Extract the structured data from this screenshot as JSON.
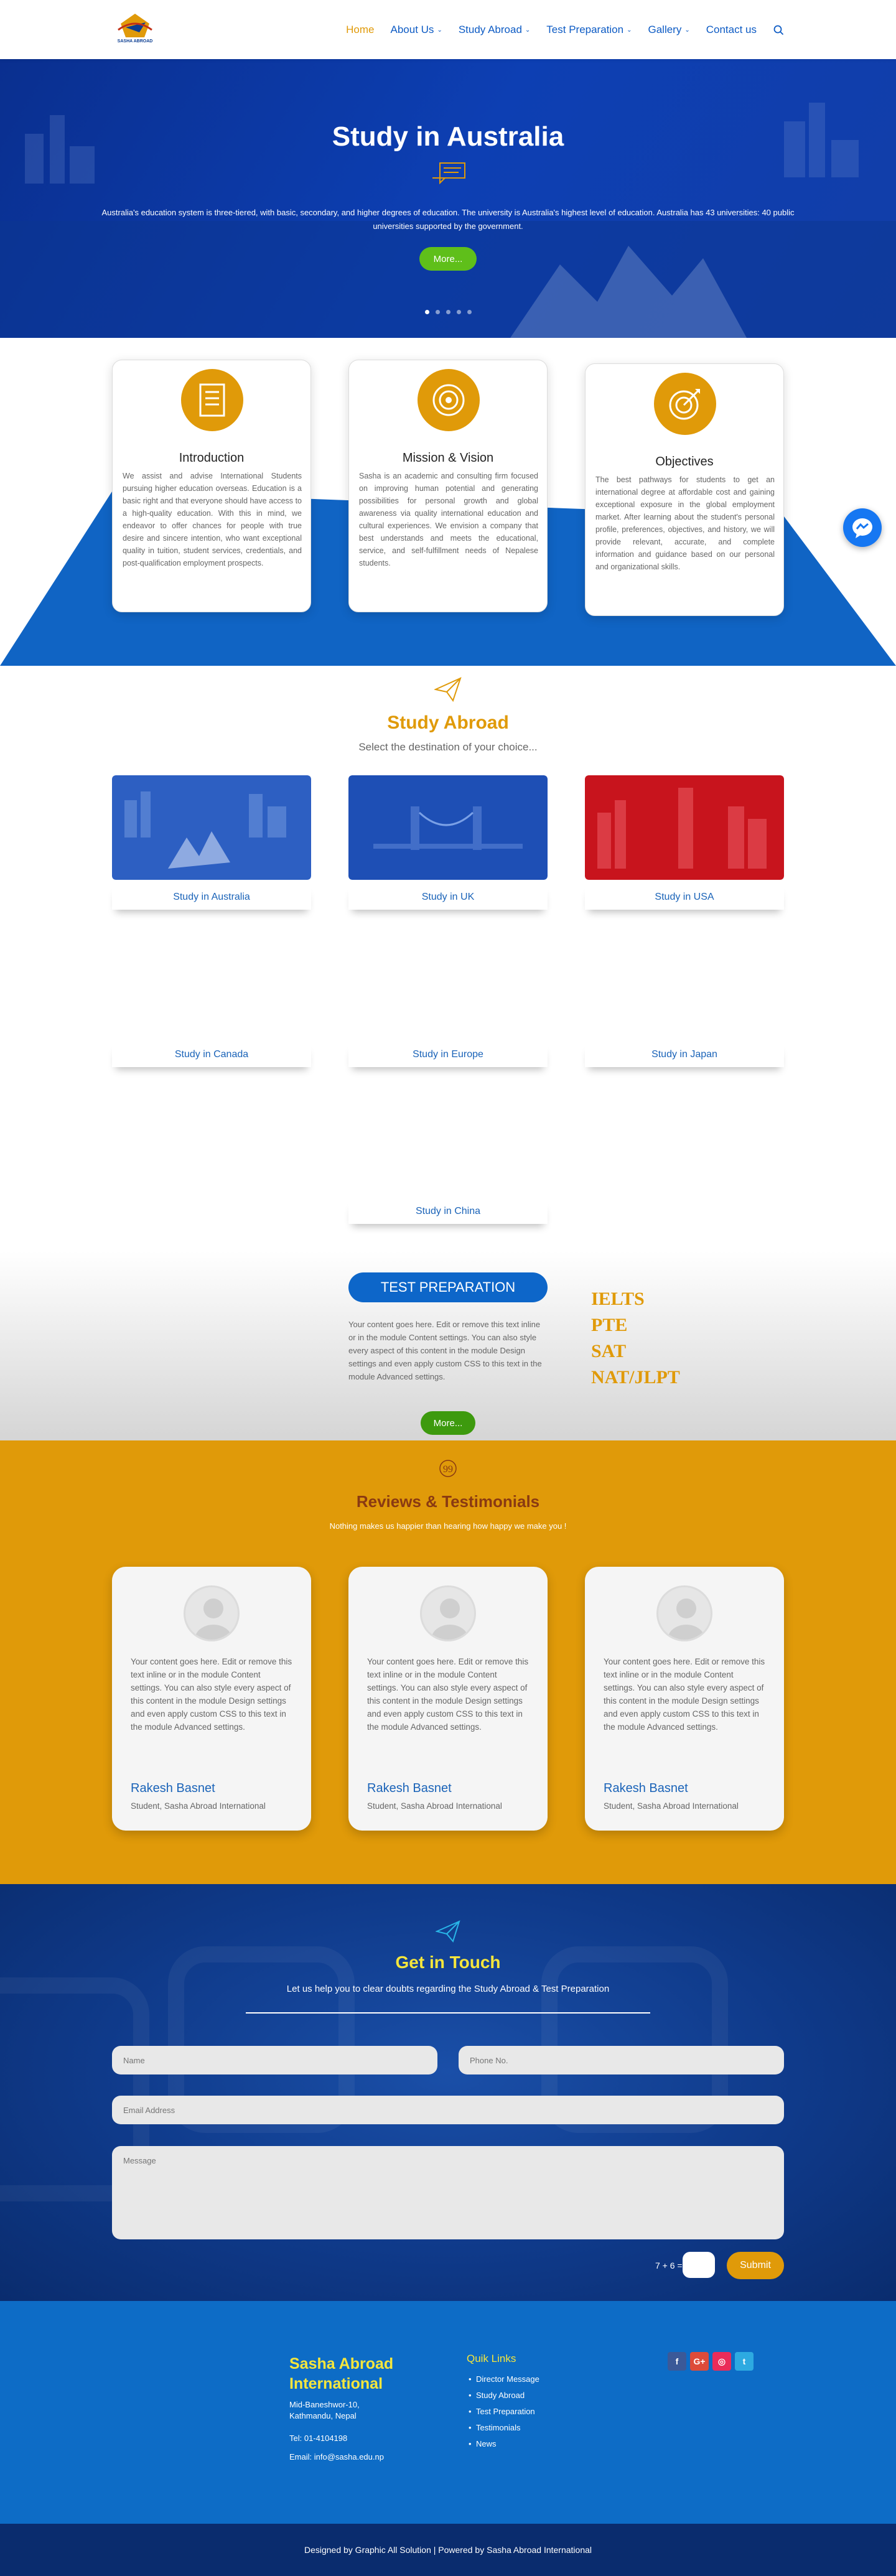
{
  "header": {
    "logo_text": "SASHA ABROAD",
    "nav": [
      {
        "label": "Home",
        "active": true,
        "dropdown": false
      },
      {
        "label": "About Us",
        "active": false,
        "dropdown": true
      },
      {
        "label": "Study Abroad",
        "active": false,
        "dropdown": true
      },
      {
        "label": "Test Preparation",
        "active": false,
        "dropdown": true
      },
      {
        "label": "Gallery",
        "active": false,
        "dropdown": true
      },
      {
        "label": "Contact us",
        "active": false,
        "dropdown": false
      }
    ]
  },
  "hero": {
    "title": "Study in Australia",
    "text": "Australia's education system is three-tiered, with basic, secondary, and higher degrees of education. The university is Australia's highest level of education. Australia has 43 universities: 40 public universities supported by the government.",
    "button": "More...",
    "slide_count": 5,
    "active_slide": 1
  },
  "info_cards": [
    {
      "title": "Introduction",
      "icon": "document-icon",
      "body": "We assist and advise International Students pursuing higher education overseas. Education is a basic right and that everyone should have access to a high-quality education. With this in mind, we endeavor to offer chances for people with true desire and sincere intention, who want exceptional quality in tuition, student services, credentials, and post-qualification employment prospects."
    },
    {
      "title": "Mission & Vision",
      "icon": "target-icon",
      "body": "Sasha is an academic and consulting firm focused on improving human potential and generating possibilities for personal growth and global awareness via quality international education and cultural experiences. We envision a company that best understands and meets the educational, service, and self-fulfillment needs of Nepalese students."
    },
    {
      "title": "Objectives",
      "icon": "dart-target-icon",
      "body": "The best pathways for students to get an international degree at affordable cost and gaining exceptional exposure in the global employment market. After learning about the student's personal profile, preferences, objectives, and history, we will provide relevant, accurate, and complete information and guidance based on our personal and organizational skills."
    }
  ],
  "study_abroad": {
    "title": "Study Abroad",
    "subtitle": "Select the destination of your choice...",
    "destinations": [
      {
        "label": "Study in Australia",
        "color": "#2d5fc2",
        "has_image": true
      },
      {
        "label": "Study in UK",
        "color": "#1e4fb5",
        "has_image": true
      },
      {
        "label": "Study in USA",
        "color": "#c8141d",
        "has_image": true
      },
      {
        "label": "Study in Canada",
        "has_image": false
      },
      {
        "label": "Study in Europe",
        "has_image": false
      },
      {
        "label": "Study in Japan",
        "has_image": false
      },
      {
        "label": "Study in China",
        "has_image": false
      }
    ]
  },
  "test_prep": {
    "title": "TEST PREPARATION",
    "body": "Your content goes here. Edit or remove this text inline or in the module Content settings. You can also style every aspect of this content in the module Design settings and even apply custom CSS to this text in the module Advanced settings.",
    "button": "More...",
    "tests": [
      "IELTS",
      "PTE",
      "SAT",
      "NAT/JLPT"
    ]
  },
  "reviews": {
    "title": "Reviews & Testimonials",
    "subtitle": "Nothing makes us happier than hearing how happy we make you !",
    "items": [
      {
        "body": "Your content goes here. Edit or remove this text inline or in the module Content settings. You can also style every aspect of this content in the module Design settings and even apply custom CSS to this text in the module Advanced settings.",
        "name": "Rakesh Basnet",
        "role": "Student, Sasha Abroad International"
      },
      {
        "body": "Your content goes here. Edit or remove this text inline or in the module Content settings. You can also style every aspect of this content in the module Design settings and even apply custom CSS to this text in the module Advanced settings.",
        "name": "Rakesh Basnet",
        "role": "Student, Sasha Abroad International"
      },
      {
        "body": "Your content goes here. Edit or remove this text inline or in the module Content settings. You can also style every aspect of this content in the module Design settings and even apply custom CSS to this text in the module Advanced settings.",
        "name": "Rakesh Basnet",
        "role": "Student, Sasha Abroad International"
      }
    ]
  },
  "contact": {
    "title": "Get in Touch",
    "subtitle": "Let us help you to clear doubts regarding the Study Abroad & Test Preparation",
    "name_placeholder": "Name",
    "phone_placeholder": "Phone No.",
    "email_placeholder": "Email Address",
    "message_placeholder": "Message",
    "captcha": "7 + 6 =",
    "submit": "Submit"
  },
  "footer": {
    "brand": "Sasha Abroad International",
    "address": "Mid-Baneshwor-10, Kathmandu, Nepal",
    "tel": "Tel: 01-4104198",
    "email": "Email: info@sasha.edu.np",
    "links_title": "Quik Links",
    "links": [
      "Director Message",
      "Study Abroad",
      "Test Preparation",
      "Testimonials",
      "News"
    ],
    "social": [
      {
        "name": "facebook-icon",
        "glyph": "f",
        "color": "#3b5998"
      },
      {
        "name": "google-plus-icon",
        "glyph": "G+",
        "color": "#dd4b39"
      },
      {
        "name": "instagram-icon",
        "glyph": "◎",
        "color": "#ea2c59"
      },
      {
        "name": "twitter-icon",
        "glyph": "t",
        "color": "#2daae1"
      }
    ],
    "copyright": "Designed by Graphic All Solution | Powered by Sasha Abroad International"
  },
  "colors": {
    "accent": "#e09a09",
    "primary": "#0d66c9",
    "nav_blue": "#0d5bc4",
    "dark_navy": "#0a2c6e"
  }
}
